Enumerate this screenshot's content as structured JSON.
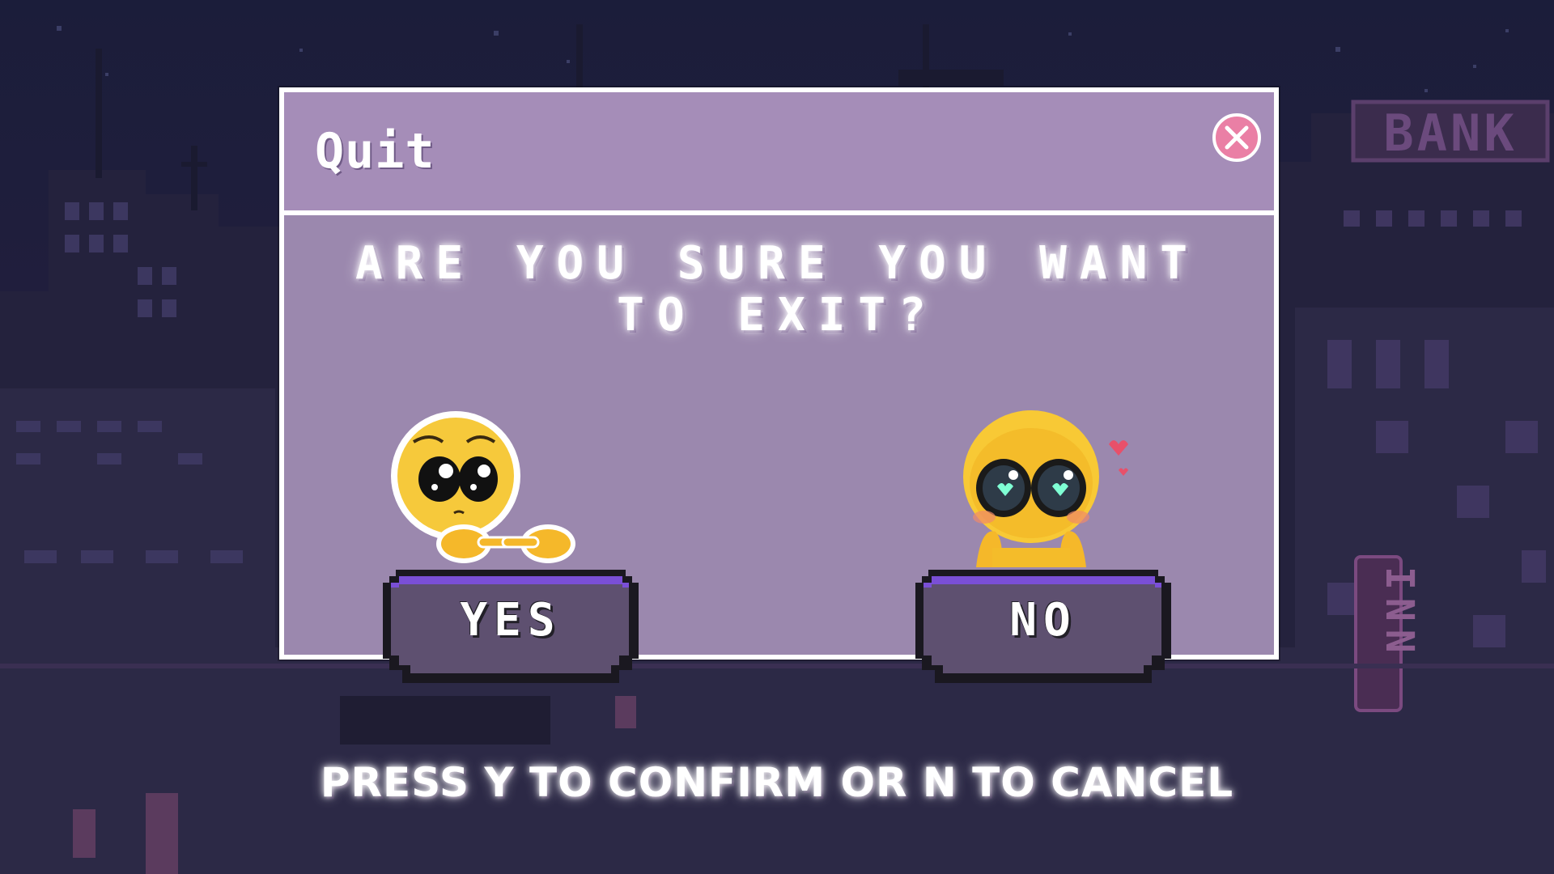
{
  "dialog": {
    "title": "Quit",
    "question": "ARE YOU SURE YOU WANT TO EXIT?",
    "yes_label": "YES",
    "no_label": "NO",
    "close_icon": "close-icon"
  },
  "hint": "PRESS Y TO CONFIRM OR N TO CANCEL",
  "background": {
    "signs": [
      "BANK",
      "INN"
    ]
  },
  "colors": {
    "dialog_bg": "#9b88ae",
    "header_bg": "#a58db8",
    "close_button": "#ea7fa5",
    "button_fill": "#5e5070",
    "button_accent": "#7a4fd6",
    "night_sky": "#1b1d3a"
  }
}
